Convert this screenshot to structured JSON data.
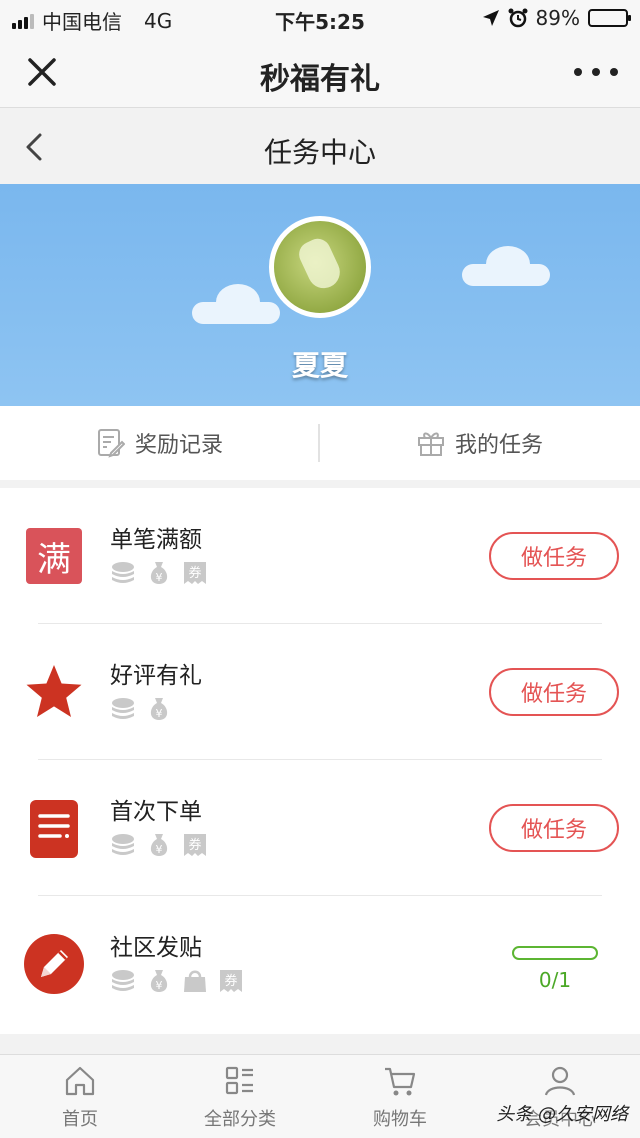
{
  "status_bar": {
    "carrier": "中国电信",
    "network": "4G",
    "time": "下午5:25",
    "battery_percent": "89%",
    "battery_level": 0.89
  },
  "title_bar": {
    "title": "秒福有礼",
    "close_icon": "close-icon",
    "more_icon": "more-dots-icon"
  },
  "nav_bar": {
    "title": "任务中心",
    "back_icon": "chevron-left-icon"
  },
  "profile": {
    "nickname": "夏夏"
  },
  "record_bar": {
    "items": [
      {
        "label": "奖励记录",
        "icon": "document-edit-icon"
      },
      {
        "label": "我的任务",
        "icon": "gift-icon"
      }
    ]
  },
  "tasks": [
    {
      "name": "单笔满额",
      "icon": "full-amount-icon",
      "icon_text": "满",
      "rewards": [
        "coins-icon",
        "money-bag-icon",
        "coupon-icon"
      ],
      "action": "做任务"
    },
    {
      "name": "好评有礼",
      "icon": "star-icon",
      "rewards": [
        "coins-icon",
        "money-bag-icon"
      ],
      "action": "做任务"
    },
    {
      "name": "首次下单",
      "icon": "order-list-icon",
      "rewards": [
        "coins-icon",
        "money-bag-icon",
        "coupon-icon"
      ],
      "action": "做任务"
    },
    {
      "name": "社区发贴",
      "icon": "pencil-icon",
      "rewards": [
        "coins-icon",
        "money-bag-icon",
        "shopping-bag-icon",
        "coupon-icon"
      ],
      "progress_text": "0/1",
      "progress": 0.0
    }
  ],
  "reward_glyphs": {
    "money": "¥",
    "coupon": "券"
  },
  "colors": {
    "accent": "#e45454",
    "hero_blue": "#7ab7ee",
    "progress_green": "#5cb532",
    "icon_red": "#cc3322"
  },
  "tabbar": {
    "items": [
      {
        "label": "首页",
        "icon": "home-icon"
      },
      {
        "label": "全部分类",
        "icon": "category-icon"
      },
      {
        "label": "购物车",
        "icon": "cart-icon"
      },
      {
        "label": "会员中心",
        "icon": "user-icon"
      }
    ]
  },
  "watermark": "头条 @久安网络"
}
